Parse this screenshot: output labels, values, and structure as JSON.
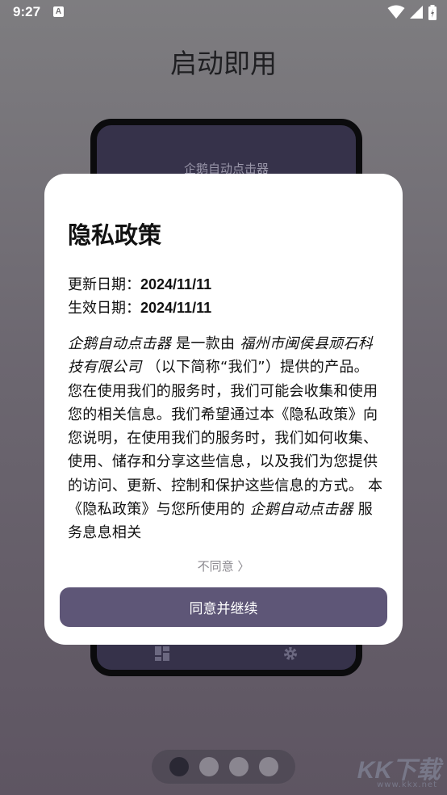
{
  "status_bar": {
    "time": "9:27",
    "notification_icon": "A"
  },
  "onboarding": {
    "title": "启动即用",
    "phone_app_title": "企鹅自动点击器",
    "page_dots": {
      "count": 4,
      "active_index": 0
    },
    "watermark": "KK下载",
    "watermark_sub": "www.kkx.net"
  },
  "dialog": {
    "title": "隐私政策",
    "update_label": "更新日期：",
    "update_value": "2024/11/11",
    "effective_label": "生效日期：",
    "effective_value": "2024/11/11",
    "body": {
      "app_name": "企鹅自动点击器",
      "s1": " 是一款由 ",
      "company": "福州市闽侯县顽石科技有限公司",
      "s2": " （以下简称“我们”）提供的产品。 您在使用我们的服务时，我们可能会收集和使用您的相关信息。我们希望通过本《隐私政策》向您说明，在使用我们的服务时，我们如何收集、使用、储存和分享这些信息，以及我们为您提供的访问、更新、控制和保护这些信息的方式。 本《隐私政策》与您所使用的 ",
      "app_name_2": "企鹅自动点击器",
      "s3": " 服务息息相关"
    },
    "disagree_label": "不同意 〉",
    "agree_label": "同意并继续"
  }
}
